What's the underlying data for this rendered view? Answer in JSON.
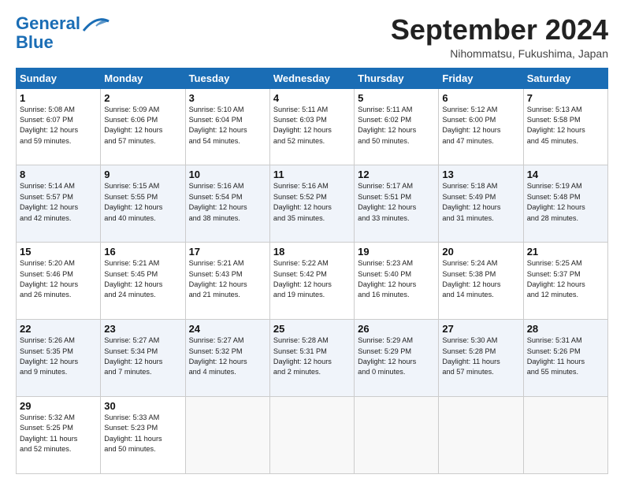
{
  "header": {
    "logo_line1": "General",
    "logo_line2": "Blue",
    "month_title": "September 2024",
    "location": "Nihommatsu, Fukushima, Japan"
  },
  "columns": [
    "Sunday",
    "Monday",
    "Tuesday",
    "Wednesday",
    "Thursday",
    "Friday",
    "Saturday"
  ],
  "weeks": [
    [
      {
        "day": "1",
        "info": "Sunrise: 5:08 AM\nSunset: 6:07 PM\nDaylight: 12 hours\nand 59 minutes."
      },
      {
        "day": "2",
        "info": "Sunrise: 5:09 AM\nSunset: 6:06 PM\nDaylight: 12 hours\nand 57 minutes."
      },
      {
        "day": "3",
        "info": "Sunrise: 5:10 AM\nSunset: 6:04 PM\nDaylight: 12 hours\nand 54 minutes."
      },
      {
        "day": "4",
        "info": "Sunrise: 5:11 AM\nSunset: 6:03 PM\nDaylight: 12 hours\nand 52 minutes."
      },
      {
        "day": "5",
        "info": "Sunrise: 5:11 AM\nSunset: 6:02 PM\nDaylight: 12 hours\nand 50 minutes."
      },
      {
        "day": "6",
        "info": "Sunrise: 5:12 AM\nSunset: 6:00 PM\nDaylight: 12 hours\nand 47 minutes."
      },
      {
        "day": "7",
        "info": "Sunrise: 5:13 AM\nSunset: 5:58 PM\nDaylight: 12 hours\nand 45 minutes."
      }
    ],
    [
      {
        "day": "8",
        "info": "Sunrise: 5:14 AM\nSunset: 5:57 PM\nDaylight: 12 hours\nand 42 minutes."
      },
      {
        "day": "9",
        "info": "Sunrise: 5:15 AM\nSunset: 5:55 PM\nDaylight: 12 hours\nand 40 minutes."
      },
      {
        "day": "10",
        "info": "Sunrise: 5:16 AM\nSunset: 5:54 PM\nDaylight: 12 hours\nand 38 minutes."
      },
      {
        "day": "11",
        "info": "Sunrise: 5:16 AM\nSunset: 5:52 PM\nDaylight: 12 hours\nand 35 minutes."
      },
      {
        "day": "12",
        "info": "Sunrise: 5:17 AM\nSunset: 5:51 PM\nDaylight: 12 hours\nand 33 minutes."
      },
      {
        "day": "13",
        "info": "Sunrise: 5:18 AM\nSunset: 5:49 PM\nDaylight: 12 hours\nand 31 minutes."
      },
      {
        "day": "14",
        "info": "Sunrise: 5:19 AM\nSunset: 5:48 PM\nDaylight: 12 hours\nand 28 minutes."
      }
    ],
    [
      {
        "day": "15",
        "info": "Sunrise: 5:20 AM\nSunset: 5:46 PM\nDaylight: 12 hours\nand 26 minutes."
      },
      {
        "day": "16",
        "info": "Sunrise: 5:21 AM\nSunset: 5:45 PM\nDaylight: 12 hours\nand 24 minutes."
      },
      {
        "day": "17",
        "info": "Sunrise: 5:21 AM\nSunset: 5:43 PM\nDaylight: 12 hours\nand 21 minutes."
      },
      {
        "day": "18",
        "info": "Sunrise: 5:22 AM\nSunset: 5:42 PM\nDaylight: 12 hours\nand 19 minutes."
      },
      {
        "day": "19",
        "info": "Sunrise: 5:23 AM\nSunset: 5:40 PM\nDaylight: 12 hours\nand 16 minutes."
      },
      {
        "day": "20",
        "info": "Sunrise: 5:24 AM\nSunset: 5:38 PM\nDaylight: 12 hours\nand 14 minutes."
      },
      {
        "day": "21",
        "info": "Sunrise: 5:25 AM\nSunset: 5:37 PM\nDaylight: 12 hours\nand 12 minutes."
      }
    ],
    [
      {
        "day": "22",
        "info": "Sunrise: 5:26 AM\nSunset: 5:35 PM\nDaylight: 12 hours\nand 9 minutes."
      },
      {
        "day": "23",
        "info": "Sunrise: 5:27 AM\nSunset: 5:34 PM\nDaylight: 12 hours\nand 7 minutes."
      },
      {
        "day": "24",
        "info": "Sunrise: 5:27 AM\nSunset: 5:32 PM\nDaylight: 12 hours\nand 4 minutes."
      },
      {
        "day": "25",
        "info": "Sunrise: 5:28 AM\nSunset: 5:31 PM\nDaylight: 12 hours\nand 2 minutes."
      },
      {
        "day": "26",
        "info": "Sunrise: 5:29 AM\nSunset: 5:29 PM\nDaylight: 12 hours\nand 0 minutes."
      },
      {
        "day": "27",
        "info": "Sunrise: 5:30 AM\nSunset: 5:28 PM\nDaylight: 11 hours\nand 57 minutes."
      },
      {
        "day": "28",
        "info": "Sunrise: 5:31 AM\nSunset: 5:26 PM\nDaylight: 11 hours\nand 55 minutes."
      }
    ],
    [
      {
        "day": "29",
        "info": "Sunrise: 5:32 AM\nSunset: 5:25 PM\nDaylight: 11 hours\nand 52 minutes."
      },
      {
        "day": "30",
        "info": "Sunrise: 5:33 AM\nSunset: 5:23 PM\nDaylight: 11 hours\nand 50 minutes."
      },
      {
        "day": "",
        "info": ""
      },
      {
        "day": "",
        "info": ""
      },
      {
        "day": "",
        "info": ""
      },
      {
        "day": "",
        "info": ""
      },
      {
        "day": "",
        "info": ""
      }
    ]
  ]
}
